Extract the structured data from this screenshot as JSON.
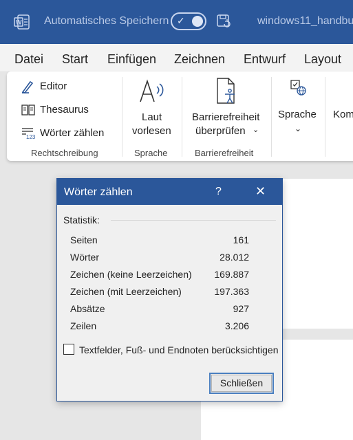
{
  "titlebar": {
    "autosave_label": "Automatisches Speichern",
    "document_title": "windows11_handbu",
    "brand_color": "#2b579a"
  },
  "menu": {
    "items": [
      "Datei",
      "Start",
      "Einfügen",
      "Zeichnen",
      "Entwurf",
      "Layout"
    ]
  },
  "ribbon": {
    "proofing": {
      "editor": "Editor",
      "thesaurus": "Thesaurus",
      "word_count": "Wörter zählen",
      "group_label": "Rechtschreibung"
    },
    "speech": {
      "read_aloud_line1": "Laut",
      "read_aloud_line2": "vorlesen",
      "group_label": "Sprache"
    },
    "accessibility": {
      "check_line1": "Barrierefreiheit",
      "check_line2": "überprüfen",
      "group_label": "Barrierefreiheit"
    },
    "language": {
      "label": "Sprache"
    },
    "comments": {
      "label": "Kom"
    }
  },
  "dialog": {
    "title": "Wörter zählen",
    "help": "?",
    "close": "✕",
    "statistik_label": "Statistik:",
    "rows": [
      {
        "label": "Seiten",
        "value": "161"
      },
      {
        "label": "Wörter",
        "value": "28.012"
      },
      {
        "label": "Zeichen (keine Leerzeichen)",
        "value": "169.887"
      },
      {
        "label": "Zeichen (mit Leerzeichen)",
        "value": "197.363"
      },
      {
        "label": "Absätze",
        "value": "927"
      },
      {
        "label": "Zeilen",
        "value": "3.206"
      }
    ],
    "checkbox_label": "Textfelder, Fuß- und Endnoten berücksichtigen",
    "checkbox_checked": false,
    "close_button": "Schließen"
  }
}
